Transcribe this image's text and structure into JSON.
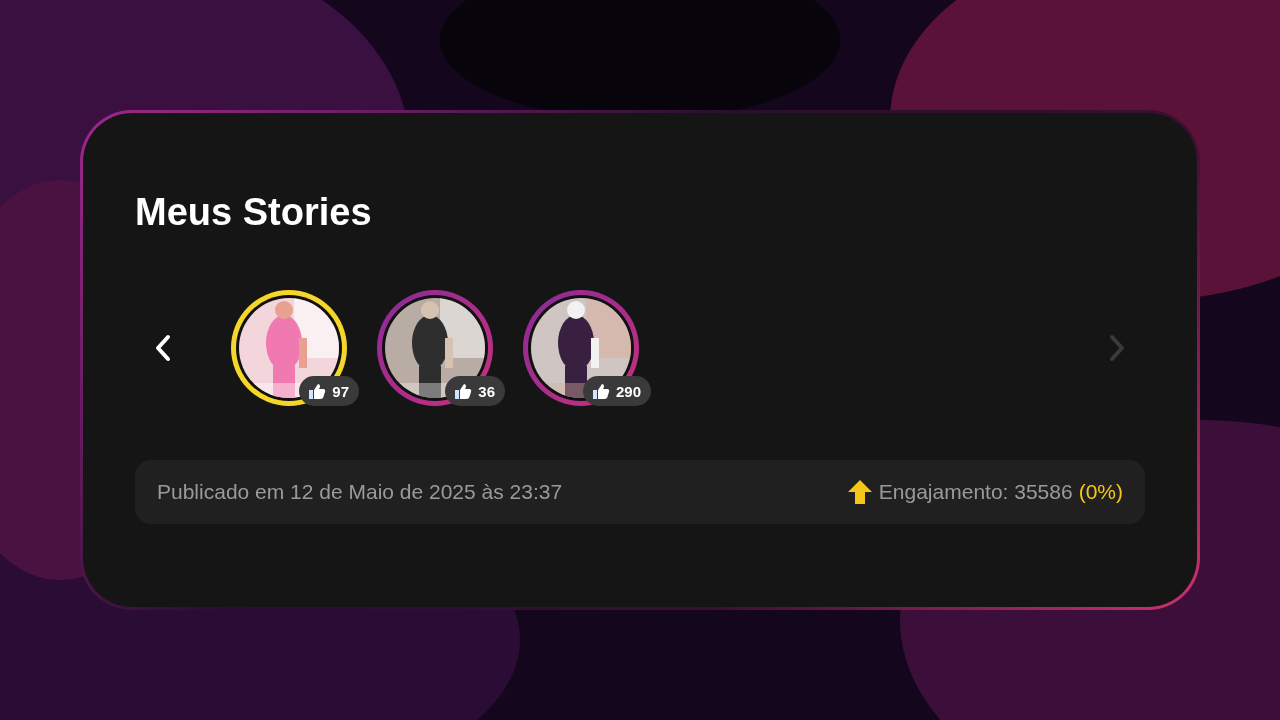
{
  "title": "Meus Stories",
  "carousel": {
    "prev_disabled": false,
    "next_disabled": true,
    "stories": [
      {
        "selected": true,
        "likes": "97",
        "kind": "picture"
      },
      {
        "selected": false,
        "likes": "36",
        "kind": "picture"
      },
      {
        "selected": false,
        "likes": "290",
        "kind": "picture"
      }
    ]
  },
  "footer": {
    "published": "Publicado em 12 de Maio de 2025 às 23:37",
    "engagement": "Engajamento: 35586",
    "change": "(0%)"
  }
}
